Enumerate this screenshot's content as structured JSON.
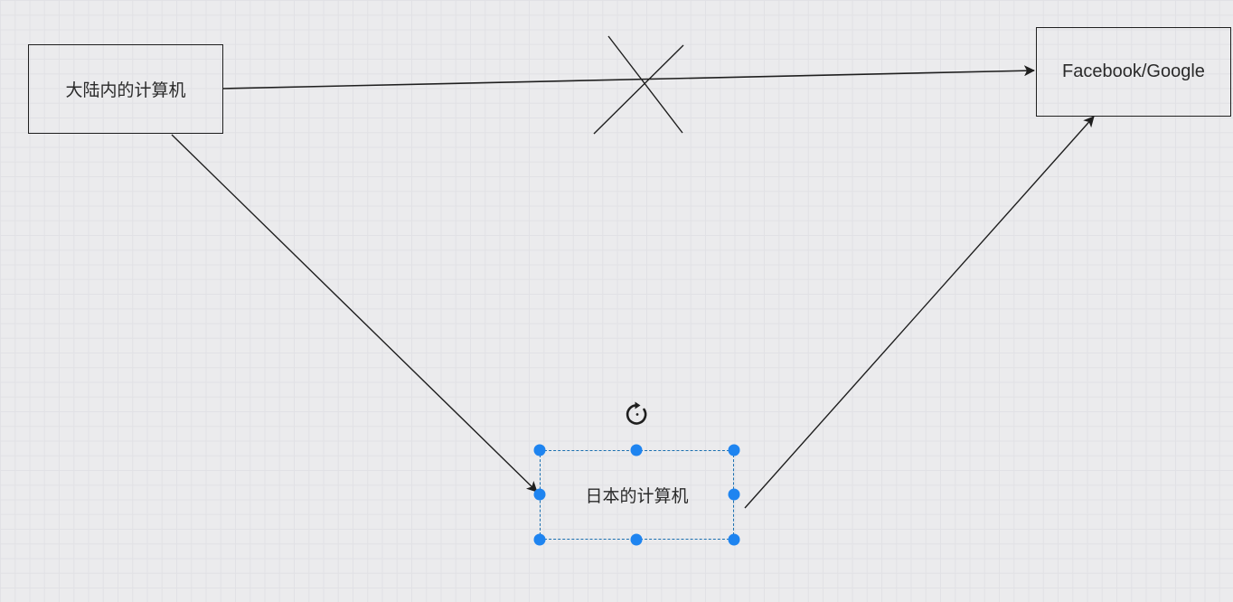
{
  "diagram": {
    "nodes": {
      "mainland": {
        "label": "大陆内的计算机"
      },
      "facebook": {
        "label": "Facebook/Google"
      },
      "japan": {
        "label": "日本的计算机",
        "selected": true
      }
    },
    "edges": [
      {
        "from": "mainland",
        "to": "facebook",
        "blocked": true
      },
      {
        "from": "mainland",
        "to": "japan",
        "blocked": false
      },
      {
        "from": "japan",
        "to": "facebook",
        "blocked": false
      }
    ],
    "selection_handles": [
      "top-left",
      "top",
      "top-right",
      "left",
      "right",
      "bottom-left",
      "bottom",
      "bottom-right"
    ],
    "tools": {
      "rotate_icon": "rotate-icon"
    }
  },
  "colors": {
    "canvas_bg": "#ebebed",
    "grid_line": "#d9d9de",
    "stroke": "#1f1f1f",
    "selection_border": "#1a6fb0",
    "handle_fill": "#1e84f0"
  }
}
